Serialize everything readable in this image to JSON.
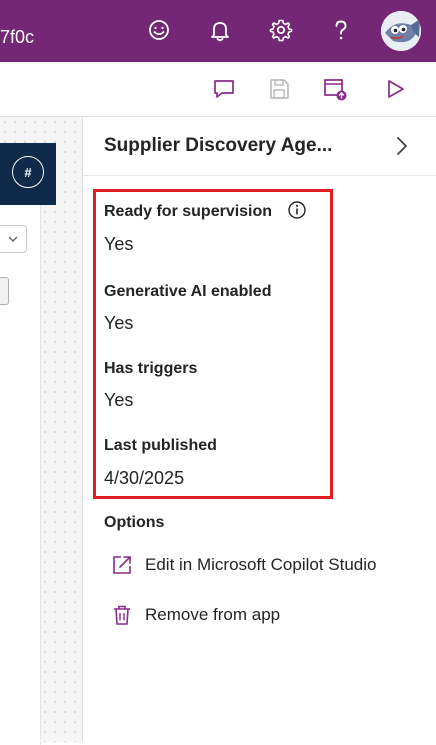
{
  "topbar": {
    "environment_suffix": "7f0c",
    "icons": [
      "smiley-icon",
      "bell-icon",
      "gear-icon",
      "help-icon",
      "avatar"
    ]
  },
  "commandbar": {
    "icons": [
      "comment-icon",
      "save-icon",
      "publish-icon",
      "play-icon"
    ]
  },
  "canvas": {
    "badge": "#"
  },
  "panel": {
    "title": "Supplier Discovery Age...",
    "properties": [
      {
        "label": "Ready for supervision",
        "value": "Yes"
      },
      {
        "label": "Generative AI enabled",
        "value": "Yes"
      },
      {
        "label": "Has triggers",
        "value": "Yes"
      },
      {
        "label": "Last published",
        "value": "4/30/2025"
      }
    ],
    "options_label": "Options",
    "options": [
      {
        "label": "Edit in Microsoft Copilot Studio",
        "icon": "open-external-icon"
      },
      {
        "label": "Remove from app",
        "icon": "trash-icon"
      }
    ]
  },
  "colors": {
    "brand": "#742774",
    "highlight": "#e01e22",
    "icon_accent": "#8a2a8a"
  }
}
